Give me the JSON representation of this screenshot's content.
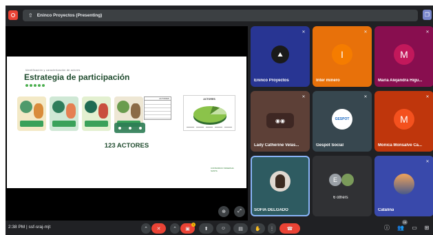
{
  "topbar": {
    "presenting_title": "Eninco Proyectos (Presenting)"
  },
  "slide": {
    "eyebrow": "Identificación y caracterización de actores",
    "title": "Estrategia de participación",
    "table_headers": [
      "",
      "ACTORES"
    ],
    "chart_title": "ACTORES",
    "big_text": "123 ACTORES",
    "logo_text": "CONSORCIO SINERGIA SANTA"
  },
  "participants": [
    {
      "name": "Eninco Proyectos",
      "color": "#283593",
      "avatar": "",
      "mic": "muted"
    },
    {
      "name": "Inter minero",
      "color": "#e8710a",
      "avatar": "I",
      "mic": "muted"
    },
    {
      "name": "Maria Alejandra Higu...",
      "color": "#880e4f",
      "avatar": "M",
      "mic": "muted"
    },
    {
      "name": "Lady Catherine Velas...",
      "color": "#5d4037",
      "avatar": "",
      "mic": "muted"
    },
    {
      "name": "Gespot Social",
      "color": "#37474f",
      "avatar": "",
      "mic": "muted"
    },
    {
      "name": "Monica Monsalve Ca...",
      "color": "#bf360c",
      "avatar": "M",
      "mic": "muted"
    },
    {
      "name": "SOFIA DELGADO",
      "color": "#2e5b61",
      "avatar": "",
      "mic": ""
    },
    {
      "name": "6 others",
      "color": "#303134",
      "avatar": "E",
      "mic": ""
    },
    {
      "name": "Catalina",
      "color": "#3949ab",
      "avatar": "",
      "mic": "muted"
    }
  ],
  "bottombar": {
    "time_meeting": "2:38 PM  |  ssf-sraj-mjt",
    "participants_badge": "15",
    "notification_count": "1"
  },
  "colors": {
    "background": "#202124",
    "accent_red": "#ea4335",
    "active_outline": "#8ab4f8",
    "brand_green": "#1f4b2e"
  },
  "icons": [
    "record-icon",
    "present-icon",
    "sidebar-icon",
    "zoom-icon",
    "fullscreen-icon",
    "chevron-up-icon",
    "mic-off-icon",
    "camera-off-icon",
    "present-now-icon",
    "emoji-icon",
    "captions-icon",
    "raise-hand-icon",
    "more-icon",
    "hangup-icon",
    "info-icon",
    "people-icon",
    "chat-icon",
    "activities-icon"
  ]
}
